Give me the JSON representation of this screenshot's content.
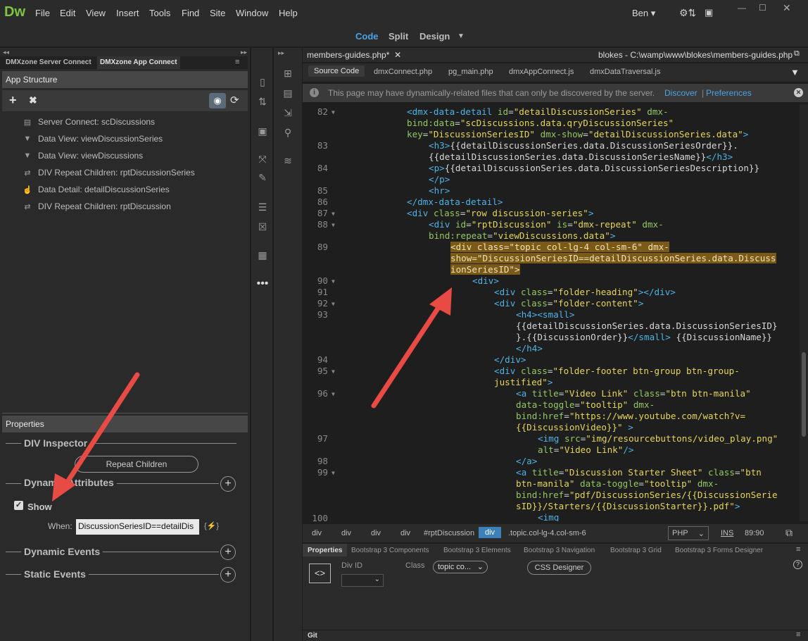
{
  "app": {
    "logo": "Dw",
    "menu": [
      "File",
      "Edit",
      "View",
      "Insert",
      "Tools",
      "Find",
      "Site",
      "Window",
      "Help"
    ],
    "user": "Ben"
  },
  "modes": {
    "code": "Code",
    "split": "Split",
    "design": "Design"
  },
  "left": {
    "tabs": [
      "DMXzone Server Connect",
      "DMXzone App Connect"
    ],
    "app_structure": "App Structure",
    "tree": [
      {
        "icon": "database-icon",
        "label": "Server Connect: scDiscussions"
      },
      {
        "icon": "filter-icon",
        "label": "Data View: viewDiscussionSeries"
      },
      {
        "icon": "filter-icon",
        "label": "Data View: viewDiscussions"
      },
      {
        "icon": "repeat-icon",
        "label": "DIV Repeat Children: rptDiscussionSeries"
      },
      {
        "icon": "hand-icon",
        "label": "Data Detail: detailDiscussionSeries"
      },
      {
        "icon": "repeat-icon",
        "label": "DIV Repeat Children: rptDiscussion"
      }
    ],
    "properties": "Properties",
    "div_inspector": "DIV Inspector",
    "repeat_children": "Repeat Children",
    "dynamic_attributes": "Dynamic Attributes",
    "show": "Show",
    "when_label": "When:",
    "when_value": "DiscussionSeriesID==detailDis",
    "dynamic_events": "Dynamic Events",
    "static_events": "Static Events"
  },
  "editor": {
    "doc_tab": "members-guides.php*",
    "path": "blokes - C:\\wamp\\www\\blokes\\members-guides.php",
    "related": [
      "Source Code",
      "dmxConnect.php",
      "pg_main.php",
      "dmxAppConnect.js",
      "dmxDataTraversal.js"
    ],
    "info": "This page may have dynamically-related files that can only be discovered by the server.",
    "discover": "Discover",
    "preferences": "Preferences",
    "line_numbers": [
      "82",
      "83",
      "84",
      "85",
      "86",
      "87",
      "88",
      "89",
      "90",
      "91",
      "92",
      "93",
      "94",
      "95",
      "96",
      "97",
      "98",
      "99",
      "100"
    ]
  },
  "status": {
    "crumbs": [
      "div",
      "div",
      "div",
      "div",
      "#rptDiscussion",
      "div",
      ".topic.col-lg-4.col-sm-6"
    ],
    "lang": "PHP",
    "ins": "INS",
    "pos": "89:90"
  },
  "props": {
    "tabs": [
      "Properties",
      "Bootstrap 3 Components",
      "Bootstrap 3 Elements",
      "Bootstrap 3 Navigation",
      "Bootstrap 3 Grid",
      "Bootstrap 3 Forms Designer"
    ],
    "div_id": "Div ID",
    "class_label": "Class",
    "class_value": "topic co...",
    "css_designer": "CSS Designer"
  },
  "git": "Git"
}
